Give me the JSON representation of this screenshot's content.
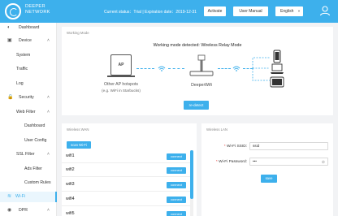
{
  "header": {
    "brand_line1": "DEEPER",
    "brand_line2": "NETWORK",
    "status": "Current status：Trial | Expiration date：2019-12-31",
    "activate_label": "Activate",
    "manual_label": "User Manual",
    "language": "English",
    "accent_color": "#3db0ec"
  },
  "sidebar": {
    "items": [
      {
        "label": "Dashboard",
        "icon": "dashboard-icon"
      },
      {
        "label": "Device",
        "icon": "device-icon"
      },
      {
        "label": "System"
      },
      {
        "label": "Traffic"
      },
      {
        "label": "Log"
      },
      {
        "label": "Security",
        "icon": "lock-icon"
      },
      {
        "label": "Web Filter"
      },
      {
        "label": "Dashboard"
      },
      {
        "label": "User Config"
      },
      {
        "label": "SSL Filter"
      },
      {
        "label": "Ads Filter"
      },
      {
        "label": "Custom Rules"
      },
      {
        "label": "Wi-Fi",
        "icon": "wifi-icon",
        "active": true
      },
      {
        "label": "DPR",
        "icon": "dpr-icon"
      }
    ]
  },
  "working_mode": {
    "title": "Working Mode",
    "message": "Working mode detected: Wireless Relay Mode",
    "ap_label": "AP",
    "ap_caption": "Other AP hotspots",
    "ap_caption_sub": "(e.g. WiFi in Starbucks)",
    "device_caption": "DeeperWifi",
    "redetect_label": "re-detect"
  },
  "wireless_wan": {
    "title": "Wireless WAN",
    "scan_label": "scan Wi-Fi",
    "connect_label": "connect",
    "networks": [
      "wifi1",
      "wifi2",
      "wifi3",
      "wifi4",
      "wifi5"
    ]
  },
  "wireless_lan": {
    "title": "Wireless LAN",
    "ssid_label": "Wi-Fi SSID:",
    "ssid_value": "ssid",
    "password_label": "Wi-Fi Password:",
    "password_value": "•••",
    "save_label": "save"
  }
}
